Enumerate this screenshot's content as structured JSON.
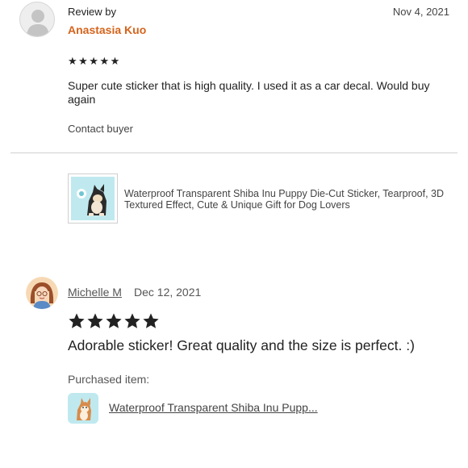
{
  "review1": {
    "label": "Review by",
    "reviewer": "Anastasia Kuo",
    "date": "Nov 4, 2021",
    "stars": "★★★★★",
    "rating": 5,
    "text": "Super cute sticker that is high quality. I used it as a car decal. Would buy again",
    "contact": "Contact buyer"
  },
  "product": {
    "title": "Waterproof Transparent Shiba Inu Puppy Die-Cut Sticker, Tearproof, 3D Textured Effect, Cute & Unique Gift for Dog Lovers"
  },
  "review2": {
    "reviewer": "Michelle M",
    "date": "Dec 12, 2021",
    "rating": 5,
    "text": "Adorable sticker! Great quality and the size is perfect. :)",
    "purchased_label": "Purchased item:",
    "purchased_item": "Waterproof Transparent Shiba Inu Pupp..."
  },
  "colors": {
    "reviewer_accent": "#d5641c",
    "thumb_bg": "#bfe9ef"
  }
}
